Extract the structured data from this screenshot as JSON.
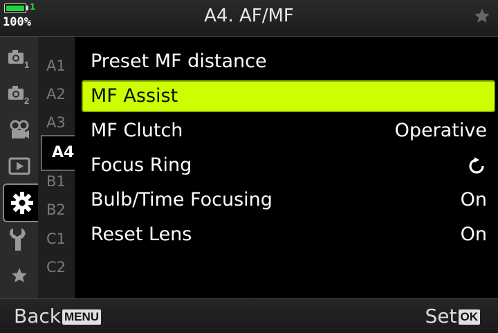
{
  "status": {
    "battery_percent": "100%",
    "battery_level": 1.0,
    "card_slot": "1",
    "battery_color": "#22d33a"
  },
  "header": {
    "title": "A4. AF/MF"
  },
  "icon_menu": [
    {
      "icon": "camera-1-icon"
    },
    {
      "icon": "camera-2-icon"
    },
    {
      "icon": "video-camera-icon"
    },
    {
      "icon": "playback-icon"
    },
    {
      "icon": "gear-icon",
      "active": true
    },
    {
      "icon": "wrench-icon"
    },
    {
      "icon": "star-icon"
    }
  ],
  "tabs": [
    {
      "label": "A1"
    },
    {
      "label": "A2"
    },
    {
      "label": "A3"
    },
    {
      "label": "A4",
      "active": true
    },
    {
      "label": "B1"
    },
    {
      "label": "B2"
    },
    {
      "label": "C1"
    },
    {
      "label": "C2"
    }
  ],
  "menu": {
    "highlight_color": "#ccff00",
    "items": [
      {
        "label": "Preset MF distance",
        "value": ""
      },
      {
        "label": "MF Assist",
        "value": "",
        "selected": true
      },
      {
        "label": "MF Clutch",
        "value": "Operative"
      },
      {
        "label": "Focus Ring",
        "value": "",
        "value_icon": "rotate-clockwise-icon"
      },
      {
        "label": "Bulb/Time Focusing",
        "value": "On"
      },
      {
        "label": "Reset Lens",
        "value": "On"
      }
    ]
  },
  "footer": {
    "back_label": "Back",
    "back_button": "MENU",
    "set_label": "Set",
    "set_button": "OK"
  }
}
